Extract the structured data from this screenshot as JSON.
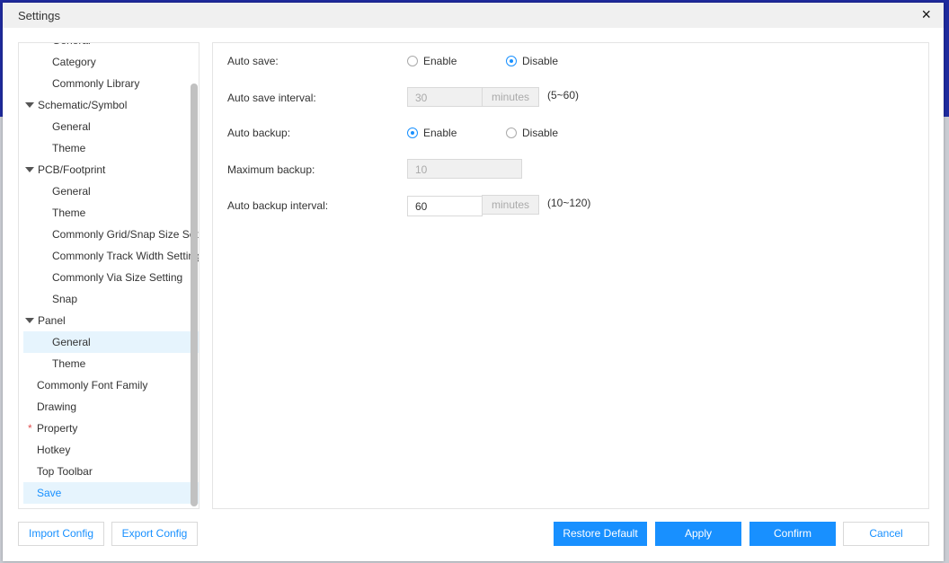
{
  "dialog": {
    "title": "Settings",
    "close": "×"
  },
  "sidebar": {
    "items": [
      {
        "label": "General",
        "level": 2
      },
      {
        "label": "Category",
        "level": 2
      },
      {
        "label": "Commonly Library",
        "level": 2
      },
      {
        "label": "Schematic/Symbol",
        "level": 0
      },
      {
        "label": "General",
        "level": 2
      },
      {
        "label": "Theme",
        "level": 2
      },
      {
        "label": "PCB/Footprint",
        "level": 0
      },
      {
        "label": "General",
        "level": 2
      },
      {
        "label": "Theme",
        "level": 2
      },
      {
        "label": "Commonly Grid/Snap Size Setting",
        "level": 2
      },
      {
        "label": "Commonly Track Width Setting",
        "level": 2
      },
      {
        "label": "Commonly Via Size Setting",
        "level": 2
      },
      {
        "label": "Snap",
        "level": 2
      },
      {
        "label": "Panel",
        "level": 0
      },
      {
        "label": "General",
        "level": 2,
        "selected": true
      },
      {
        "label": "Theme",
        "level": 2
      },
      {
        "label": "Commonly Font Family",
        "level": 1
      },
      {
        "label": "Drawing",
        "level": 1
      },
      {
        "label": "Property",
        "level": 1,
        "required": "*"
      },
      {
        "label": "Hotkey",
        "level": 1
      },
      {
        "label": "Top Toolbar",
        "level": 1
      },
      {
        "label": "Save",
        "level": 1,
        "active": true
      }
    ]
  },
  "form": {
    "auto_save": {
      "label": "Auto save:",
      "enable": "Enable",
      "disable": "Disable",
      "value": "Disable"
    },
    "auto_save_interval": {
      "label": "Auto save interval:",
      "value": "30",
      "unit": "minutes",
      "range": "(5~60)",
      "disabled": true
    },
    "auto_backup": {
      "label": "Auto backup:",
      "enable": "Enable",
      "disable": "Disable",
      "value": "Enable"
    },
    "maximum_backup": {
      "label": "Maximum backup:",
      "value": "10",
      "disabled": true
    },
    "auto_backup_interval": {
      "label": "Auto backup interval:",
      "value": "60",
      "unit": "minutes",
      "range": "(10~120)"
    }
  },
  "footer": {
    "import": "Import Config",
    "export": "Export Config",
    "restore": "Restore Default",
    "apply": "Apply",
    "confirm": "Confirm",
    "cancel": "Cancel"
  },
  "colors": {
    "accent": "#1890ff",
    "selected_bg": "#e6f4fd"
  }
}
